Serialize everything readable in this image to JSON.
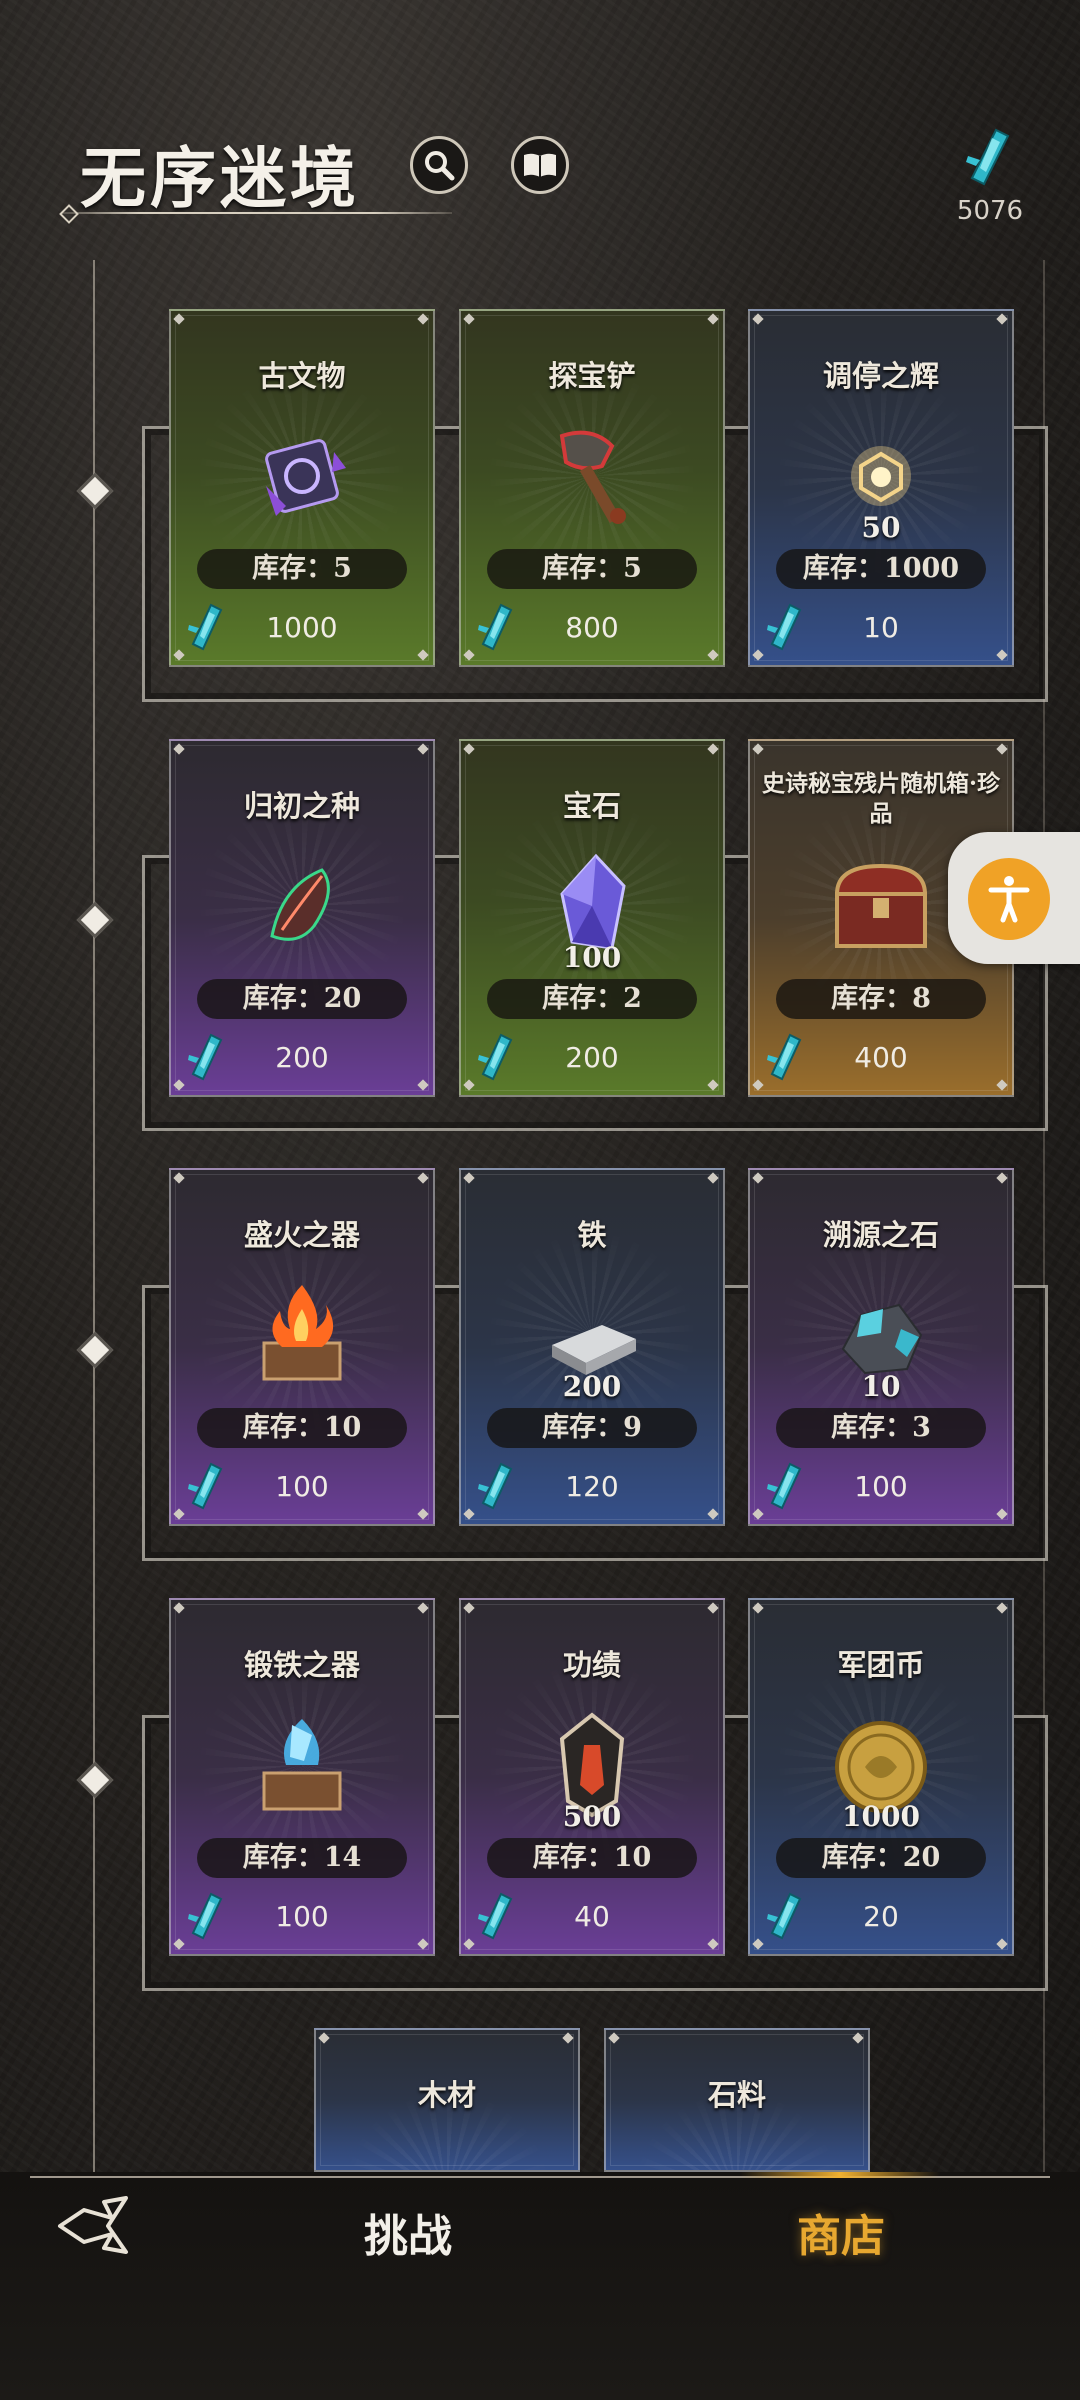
{
  "header": {
    "title": "无序迷境",
    "currency_amount": "5076"
  },
  "items": [
    {
      "name": "古文物",
      "qty": "",
      "stock": "库存：5",
      "price": "1000",
      "bg": "green",
      "icon": "artifact-icon"
    },
    {
      "name": "探宝铲",
      "qty": "",
      "stock": "库存：5",
      "price": "800",
      "bg": "green",
      "icon": "shovel-icon"
    },
    {
      "name": "调停之辉",
      "qty": "50",
      "stock": "库存：1000",
      "price": "10",
      "bg": "blue",
      "icon": "radiance-icon"
    },
    {
      "name": "归初之种",
      "qty": "",
      "stock": "库存：20",
      "price": "200",
      "bg": "purple",
      "icon": "seed-icon"
    },
    {
      "name": "宝石",
      "qty": "100",
      "stock": "库存：2",
      "price": "200",
      "bg": "green",
      "icon": "gem-icon"
    },
    {
      "name": "史诗秘宝残片随机箱·珍品",
      "qty": "",
      "stock": "库存：8",
      "price": "400",
      "bg": "gold",
      "icon": "treasure-chest-icon"
    },
    {
      "name": "盛火之器",
      "qty": "",
      "stock": "库存：10",
      "price": "100",
      "bg": "purple",
      "icon": "fire-vessel-icon"
    },
    {
      "name": "铁",
      "qty": "200",
      "stock": "库存：9",
      "price": "120",
      "bg": "blue",
      "icon": "iron-ingot-icon"
    },
    {
      "name": "溯源之石",
      "qty": "10",
      "stock": "库存：3",
      "price": "100",
      "bg": "purple",
      "icon": "origin-stone-icon"
    },
    {
      "name": "锻铁之器",
      "qty": "",
      "stock": "库存：14",
      "price": "100",
      "bg": "purple",
      "icon": "forge-vessel-icon"
    },
    {
      "name": "功绩",
      "qty": "500",
      "stock": "库存：10",
      "price": "40",
      "bg": "purple",
      "icon": "merit-icon"
    },
    {
      "name": "军团币",
      "qty": "1000",
      "stock": "库存：20",
      "price": "20",
      "bg": "blue",
      "icon": "legion-coin-icon"
    },
    {
      "name": "木材",
      "qty": "",
      "stock": "",
      "price": "",
      "bg": "blue",
      "icon": "wood-icon"
    },
    {
      "name": "石料",
      "qty": "",
      "stock": "",
      "price": "",
      "bg": "blue",
      "icon": "stone-icon"
    }
  ],
  "nav": {
    "challenge": "挑战",
    "shop": "商店"
  },
  "colors": {
    "accent_gold": "#e8a830",
    "a11y_orange": "#f0a226"
  }
}
